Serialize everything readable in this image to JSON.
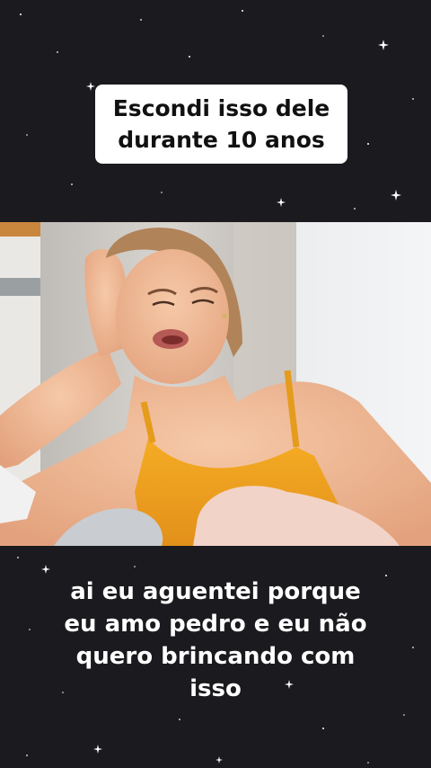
{
  "overlay": {
    "title_lines": [
      "Escondi isso dele",
      "durante 10 anos"
    ]
  },
  "caption": {
    "lines": [
      "ai eu aguentei porque",
      "eu amo pedro e eu não",
      "quero brincando com",
      "isso"
    ]
  },
  "colors": {
    "background": "#1b1a1e",
    "title_box": "#ffffff",
    "caption_text": "#ffffff",
    "top_color": "#f2a31d"
  }
}
